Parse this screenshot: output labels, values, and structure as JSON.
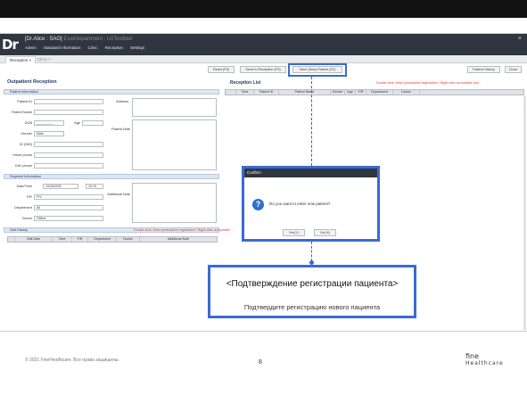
{
  "app": {
    "logo": "Dr",
    "title_main": "[Dr.Alice : SAO]",
    "title_faint": "Eval/department : Ul/Testbed",
    "menu": [
      "Admin",
      "Standard information",
      "Clinic",
      "Reception",
      "Settings"
    ],
    "close_glyph": "×"
  },
  "tabs": [
    {
      "label": "Reception ×",
      "active": true
    },
    {
      "label": "Clinic ×",
      "active": false
    }
  ],
  "toolbar": {
    "reset": "Reset (F5)",
    "send_reception": "Send to Reception (F3)",
    "save_new": "Save (New) Patient (F2)",
    "patient_history": "Patient History",
    "close": "Close"
  },
  "outpatient": {
    "title": "Outpatient Reception",
    "patient_info_head": "Patient Information",
    "labels": {
      "patient_id": "Patient ID",
      "patient_name": "Patient Name",
      "dob": "DOB",
      "age": "Age",
      "gender": "Gender",
      "id_nid": "ID (NID)",
      "home_phone": "Home phone",
      "cell_phone": "Cell. phone",
      "address": "Address",
      "patient_note": "Patient Note"
    },
    "dob_value": "____-__-__",
    "gender_value": "Male",
    "segment_head": "Segment Information",
    "seg_labels": {
      "datetime": "Date/Time",
      "fr": "F/R",
      "department": "Department",
      "doctor": "Doctor",
      "additional_note": "Additional Note"
    },
    "date_value": "10/25/2020",
    "time_value": "10:19",
    "fr_value": "F/V",
    "department_value": "All",
    "doctor_value": "Officer",
    "visit_history_head": "Visit History",
    "visit_note": "Double-click: Move prescription registration / Right-click: acceptable...",
    "visit_columns": [
      "Visit Date",
      "Time",
      "F/R",
      "Department",
      "Doctor",
      "Additional Note"
    ]
  },
  "reception_list": {
    "title": "Reception List",
    "note": "Double-click: Move prescription registration / Right-click: acceptable cha...",
    "columns": [
      "Time",
      "Patient ID",
      "Patient Name",
      "Gender",
      "Age",
      "F/R",
      "Department",
      "Doctor"
    ]
  },
  "dialog": {
    "title": "Confirm",
    "icon": "?",
    "message": "Do you want to enter new patient?",
    "yes": "Yes(Y)",
    "no": "No(N)"
  },
  "callout": {
    "title": "<Подтверждение регистрации пациента>",
    "subtitle": "Подтвердите регистрацию нового пациента"
  },
  "footer": {
    "copyright": "© 2021 FineHealthcare. Все права защищены.",
    "page": "8",
    "brand_top": "fine",
    "brand_bottom": "Healthcare"
  },
  "colors": {
    "accent": "#3b6bd1",
    "titlebar": "#2f3640",
    "note_red": "#d93a2b"
  }
}
